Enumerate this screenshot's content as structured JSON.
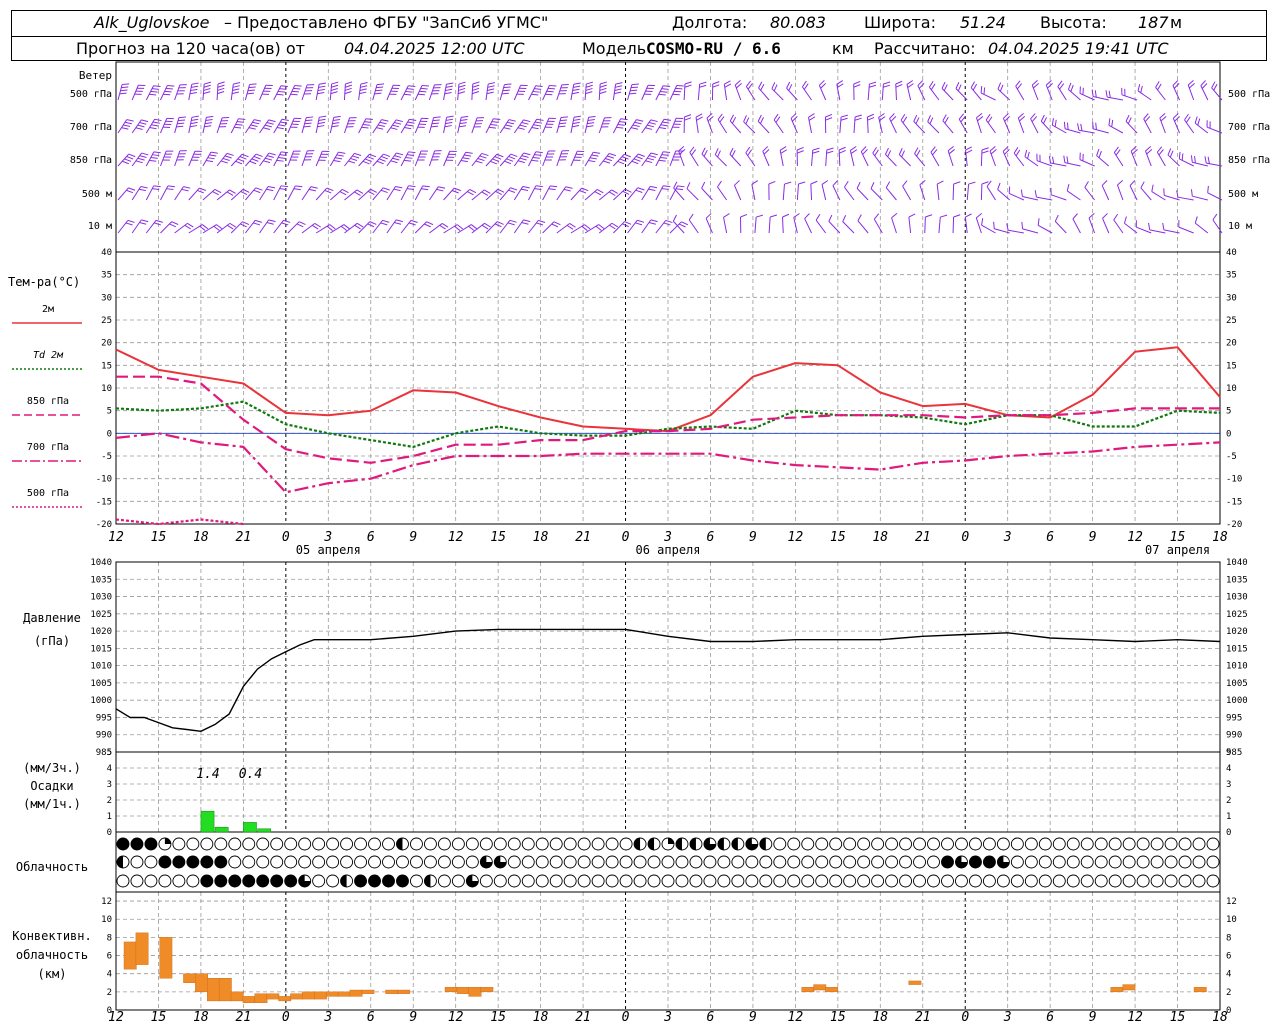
{
  "header": {
    "station": "Alk_Uglovskoe",
    "provider": " – Предоставлено ФГБУ \"ЗапСиб УГМС\"",
    "lon_label": "Долгота:",
    "lon_value": "80.083",
    "lat_label": "Широта:",
    "lat_value": "51.24",
    "alt_label": "Высота:",
    "alt_value": "187",
    "alt_unit": "м",
    "forecast_prefix": "Прогноз на 120 часа(ов) от",
    "forecast_start": "04.04.2025 12:00 UTC",
    "model_label": "Модель",
    "model_name": "COSMO-RU / 6.6",
    "model_unit": "км",
    "calc_label": "Рассчитано:",
    "calc_time": "04.04.2025 19:41 UTC"
  },
  "colors": {
    "wind": "#8a2be2",
    "t2m": "#e8343a",
    "td2m": "#0e7a0e",
    "t850": "#e0197d",
    "t700": "#e0197d",
    "t500": "#e0197d",
    "pressure": "#000000",
    "precip": "#22dd22",
    "convective": "#f08c28",
    "grid": "#9a9a9a"
  },
  "wind_panel": {
    "title": "Ветер",
    "levels": [
      "500 гПа",
      "700 гПа",
      "850 гПа",
      "500 м",
      "10  м"
    ]
  },
  "temp_panel": {
    "title": "Тем-ра(°C)",
    "legend": [
      {
        "label": "2м",
        "style": "solid",
        "key": "t2m"
      },
      {
        "label": "Td 2м",
        "style": "dotted",
        "key": "td2m"
      },
      {
        "label": "850 гПа",
        "style": "dashed",
        "key": "t850"
      },
      {
        "label": "700 гПа",
        "style": "dashdot",
        "key": "t700"
      },
      {
        "label": "500 гПа",
        "style": "dotted",
        "key": "t500"
      }
    ],
    "yticks": [
      40,
      35,
      30,
      25,
      20,
      15,
      10,
      5,
      0,
      -5,
      -10,
      -15,
      -20
    ],
    "date_labels": [
      "05 апреля",
      "06 апреля",
      "07 апреля"
    ]
  },
  "pressure_panel": {
    "title": "Давление",
    "unit": "(гПа)",
    "yticks": [
      1040,
      1035,
      1030,
      1025,
      1020,
      1015,
      1010,
      1005,
      1000,
      995,
      990,
      985
    ]
  },
  "precip_panel": {
    "unit1": "(мм/3ч.)",
    "title": "Осадки",
    "unit2": "(мм/1ч.)",
    "yticks": [
      5,
      4,
      3,
      2,
      1,
      0
    ],
    "annotations": [
      "1.4",
      "0.4"
    ]
  },
  "cloud_panel": {
    "title": "Облачность",
    "rows": [
      "FFFQAAAAAAAAAAAAAAAAHAAAAAAAAAAAAAAAAHHQHHTHHTHAAAAAAAAAAAAAAAAAAAAAAAAAAAAAAAAAATHTHAHAHFFTFF",
      "HAAFFFFFAAAAAAAAAAAAAAAAAATTAAAAAAAAAAAAAAAAAAAAAAAAAAAAAAAFTFFTAAAAAAAAAAAAAAAAAAAAAAAAAAAAAT",
      "AAAAAAFFFFFFFTAAHFFFFAHAATAAAAAAAAAAAAAAAAAAAAAAAAAAAAAAAAAAAAAAAAAAAAAAAAAAAAAAAAAAAAAAAAAAA"
    ]
  },
  "conv_panel": {
    "title1": "Конвективн.",
    "title2": "облачность",
    "unit": "(км)",
    "yticks": [
      12,
      10,
      8,
      6,
      4,
      2,
      0
    ]
  },
  "x_axis": {
    "tick_labels": [
      "12",
      "15",
      "18",
      "21",
      "0",
      "3",
      "6",
      "9",
      "12",
      "15",
      "18",
      "21",
      "0",
      "3",
      "6",
      "9",
      "12",
      "15",
      "18",
      "21",
      "0",
      "3",
      "6",
      "9",
      "12",
      "15",
      "18"
    ]
  },
  "chart_data": [
    {
      "type": "line",
      "title": "Тем-ра(°C)",
      "x": [
        0,
        3,
        6,
        9,
        12,
        15,
        18,
        21,
        24,
        27,
        30,
        33,
        36,
        39,
        42,
        45,
        48,
        51,
        54,
        57,
        60,
        63,
        66,
        69,
        72,
        75,
        78
      ],
      "ylim": [
        -20,
        40
      ],
      "series": [
        {
          "name": "2м",
          "values": [
            18.5,
            14,
            12.5,
            11,
            4.5,
            4,
            5,
            9.5,
            9,
            6,
            3.5,
            1.5,
            1,
            0.5,
            4,
            12.5,
            15.5,
            15,
            9,
            6,
            6.5,
            4,
            3.5,
            8.5,
            18,
            19,
            8
          ]
        },
        {
          "name": "Td 2м",
          "values": [
            5.5,
            5,
            5.5,
            7,
            2,
            0,
            -1.5,
            -3,
            0,
            1.5,
            0,
            -0.5,
            -0.5,
            1,
            1.5,
            1,
            5,
            4,
            4,
            3.5,
            2,
            4,
            4,
            1.5,
            1.5,
            5,
            4.5
          ]
        },
        {
          "name": "850 гПа",
          "values": [
            12.5,
            12.5,
            11,
            3,
            -3.5,
            -5.5,
            -6.5,
            -5,
            -2.5,
            -2.5,
            -1.5,
            -1.5,
            0.5,
            0.5,
            1,
            3,
            3.5,
            4,
            4,
            4,
            3.5,
            4,
            4,
            4.5,
            5.5,
            5.5,
            5.5
          ]
        },
        {
          "name": "700 гПа",
          "values": [
            -1,
            0,
            -2,
            -3,
            -13,
            -11,
            -10,
            -7,
            -5,
            -5,
            -5,
            -4.5,
            -4.5,
            -4.5,
            -4.5,
            -6,
            -7,
            -7.5,
            -8,
            -6.5,
            -6,
            -5,
            -4.5,
            -4,
            -3,
            -2.5,
            -2
          ]
        },
        {
          "name": "500 гПа",
          "values": [
            -19,
            -20,
            -19,
            -20,
            null,
            null,
            null,
            null,
            null,
            null,
            null,
            null,
            null,
            null,
            null,
            null,
            null,
            null,
            null,
            null,
            null,
            null,
            null,
            null,
            null,
            null,
            null
          ]
        }
      ]
    },
    {
      "type": "line",
      "title": "Давление",
      "ylim": [
        985,
        1040
      ],
      "x": [
        0,
        1,
        2,
        3,
        4,
        5,
        6,
        7,
        8,
        9,
        10,
        11,
        12,
        13,
        14,
        15,
        18,
        21,
        24,
        27,
        30,
        33,
        36,
        39,
        42,
        45,
        48,
        51,
        54,
        57,
        60,
        63,
        66,
        69,
        72,
        75,
        78
      ],
      "series": [
        {
          "name": "Давление",
          "values": [
            997.5,
            995,
            995,
            993.5,
            992,
            991.5,
            991,
            993,
            996,
            1004,
            1009,
            1012,
            1014,
            1016,
            1017.5,
            1017.5,
            1017.5,
            1018.5,
            1020,
            1020.5,
            1020.5,
            1020.5,
            1020.5,
            1018.5,
            1017,
            1017,
            1017.5,
            1017.5,
            1017.5,
            1018.5,
            1019,
            1019.5,
            1018,
            1017.5,
            1017,
            1017.5,
            1017
          ]
        }
      ]
    },
    {
      "type": "bar",
      "title": "Осадки",
      "ylim": [
        0,
        5
      ],
      "x": [
        6,
        7,
        9,
        10
      ],
      "values": [
        1.3,
        0.3,
        0.6,
        0.2
      ]
    },
    {
      "type": "bar",
      "title": "Конвективн. облачность",
      "ylim": [
        0,
        13
      ],
      "bars": [
        {
          "t": 0.5,
          "base": 4.5,
          "top": 7.5
        },
        {
          "t": 1.5,
          "base": 5.0,
          "top": 8.5
        },
        {
          "t": 3.5,
          "base": 3.5,
          "top": 8.0
        },
        {
          "t": 5.5,
          "base": 3.0,
          "top": 4.0
        },
        {
          "t": 6.5,
          "base": 2.0,
          "top": 4.0
        },
        {
          "t": 7.5,
          "base": 1.0,
          "top": 3.5
        },
        {
          "t": 8.5,
          "base": 1.0,
          "top": 3.5
        },
        {
          "t": 9.5,
          "base": 1.0,
          "top": 2.0
        },
        {
          "t": 10.5,
          "base": 0.8,
          "top": 1.5
        },
        {
          "t": 11.5,
          "base": 0.8,
          "top": 1.8
        },
        {
          "t": 12.5,
          "base": 1.2,
          "top": 1.8
        },
        {
          "t": 13.5,
          "base": 1.0,
          "top": 1.5
        },
        {
          "t": 14.5,
          "base": 1.2,
          "top": 1.8
        },
        {
          "t": 15.5,
          "base": 1.2,
          "top": 2.0
        },
        {
          "t": 16.5,
          "base": 1.2,
          "top": 2.0
        },
        {
          "t": 17.5,
          "base": 1.5,
          "top": 2.0
        },
        {
          "t": 18.5,
          "base": 1.5,
          "top": 2.0
        },
        {
          "t": 19.5,
          "base": 1.5,
          "top": 2.2
        },
        {
          "t": 20.5,
          "base": 1.8,
          "top": 2.2
        },
        {
          "t": 22.5,
          "base": 1.8,
          "top": 2.2
        },
        {
          "t": 23.5,
          "base": 1.8,
          "top": 2.2
        },
        {
          "t": 27.5,
          "base": 2.0,
          "top": 2.5
        },
        {
          "t": 28.5,
          "base": 1.8,
          "top": 2.5
        },
        {
          "t": 29.5,
          "base": 1.5,
          "top": 2.5
        },
        {
          "t": 30.5,
          "base": 2.0,
          "top": 2.5
        },
        {
          "t": 57.5,
          "base": 2.0,
          "top": 2.5
        },
        {
          "t": 58.5,
          "base": 2.2,
          "top": 2.8
        },
        {
          "t": 59.5,
          "base": 2.0,
          "top": 2.5
        },
        {
          "t": 66.5,
          "base": 2.8,
          "top": 3.2
        },
        {
          "t": 83.5,
          "base": 2.0,
          "top": 2.5
        },
        {
          "t": 84.5,
          "base": 2.2,
          "top": 2.8
        },
        {
          "t": 90.5,
          "base": 2.0,
          "top": 2.5
        }
      ]
    }
  ]
}
